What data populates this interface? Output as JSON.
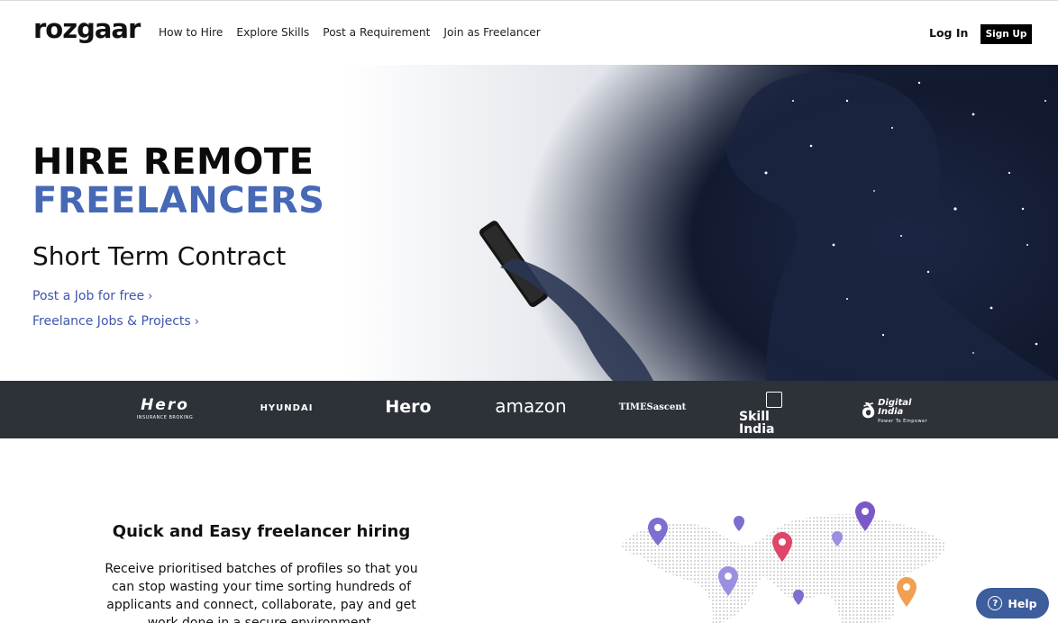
{
  "header": {
    "logo": "rozgaar",
    "nav": [
      "How to Hire",
      "Explore Skills",
      "Post a Requirement",
      "Join as Freelancer"
    ],
    "login": "Log In",
    "signup": "Sign Up"
  },
  "hero": {
    "title_line1": "HIRE REMOTE",
    "title_line2": "FREELANCERS",
    "subtitle": "Short Term Contract",
    "links": [
      "Post a Job for free",
      "Freelance Jobs & Projects"
    ],
    "accent_color": "#4769b5",
    "link_color": "#3d56a8"
  },
  "partners": [
    {
      "name": "Hero",
      "sub": "INSURANCE BROKING"
    },
    {
      "name": "HYUNDAI"
    },
    {
      "name": "Hero"
    },
    {
      "name": "amazon"
    },
    {
      "name": "TIMESascent"
    },
    {
      "name": "Skill India"
    },
    {
      "name": "Digital India",
      "sub": "Power To Empower"
    }
  ],
  "section": {
    "title": "Quick and Easy freelancer hiring",
    "body": "Receive prioritised batches of profiles so that you can stop wasting your time sorting hundreds of applicants and connect, collaborate, pay and get work done in a secure environment."
  },
  "help": {
    "label": "Help",
    "icon": "question-icon"
  },
  "colors": {
    "band": "#2d3138",
    "help": "#3d5d9c"
  }
}
